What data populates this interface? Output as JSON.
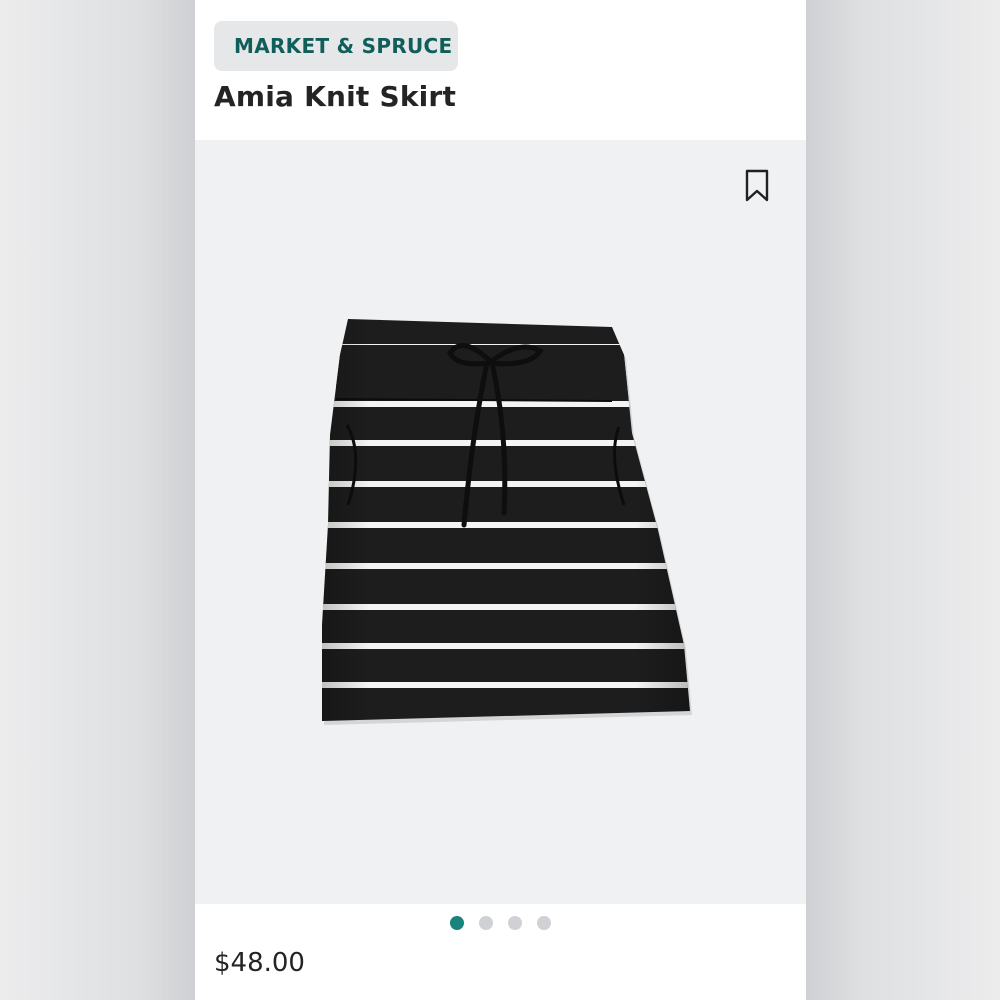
{
  "product": {
    "brand": "MARKET & SPRUCE",
    "name": "Amia Knit Skirt",
    "price": "$48.00"
  },
  "image_carousel": {
    "total_images": 4,
    "active_index": 0
  },
  "icons": {
    "bookmark": "bookmark-icon"
  },
  "colors": {
    "brand_text": "#0f5e5a",
    "chip_background": "#e6e7e8",
    "active_dot": "#18847c",
    "inactive_dot": "#cfd1d4",
    "image_background": "#f0f1f3"
  }
}
